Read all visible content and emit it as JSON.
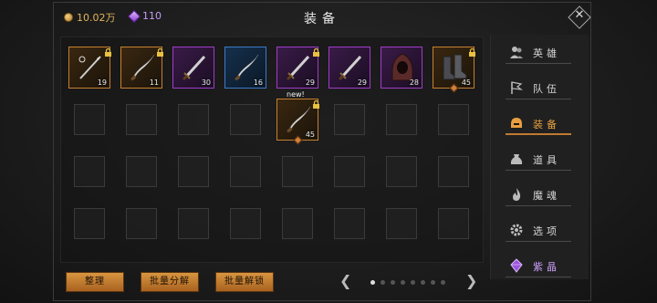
{
  "header": {
    "title": "装备",
    "gold": "10.02万",
    "gems": "110",
    "close_glyph": "✕"
  },
  "slots": [
    {
      "level": "19",
      "rarity": "orange",
      "locked": true,
      "icon": "spear-icon"
    },
    {
      "level": "11",
      "rarity": "orange",
      "locked": true,
      "icon": "scimitar-icon"
    },
    {
      "level": "30",
      "rarity": "purple",
      "locked": false,
      "icon": "sword-icon"
    },
    {
      "level": "16",
      "rarity": "blue",
      "locked": false,
      "icon": "scimitar-icon"
    },
    {
      "level": "29",
      "rarity": "purple",
      "locked": true,
      "icon": "sword-icon"
    },
    {
      "level": "29",
      "rarity": "purple",
      "locked": false,
      "icon": "sword-icon"
    },
    {
      "level": "28",
      "rarity": "purple",
      "locked": false,
      "icon": "hood-icon"
    },
    {
      "level": "45",
      "rarity": "orange",
      "locked": true,
      "icon": "boots-icon"
    },
    {
      "level": "45",
      "rarity": "orange",
      "locked": true,
      "icon": "scimitar-icon",
      "new": "new!"
    }
  ],
  "menu": [
    {
      "label": "英雄",
      "icon": "heroes-icon"
    },
    {
      "label": "队伍",
      "icon": "flag-icon"
    },
    {
      "label": "装备",
      "icon": "helmet-icon",
      "active": true
    },
    {
      "label": "道具",
      "icon": "bag-icon"
    },
    {
      "label": "魔魂",
      "icon": "flame-icon"
    },
    {
      "label": "选项",
      "icon": "gear-icon"
    },
    {
      "label": "紫晶",
      "icon": "crystal-icon"
    }
  ],
  "buttons": {
    "sort": "整理",
    "batch_decompose": "批量分解",
    "batch_unlock": "批量解锁"
  },
  "pager": {
    "pages": 8,
    "current": 1,
    "prev": "❮",
    "next": "❯"
  },
  "colors": {
    "orange": "#c5802f",
    "purple": "#a03cc8",
    "blue": "#3c7ac8",
    "accent": "#e6a040"
  }
}
